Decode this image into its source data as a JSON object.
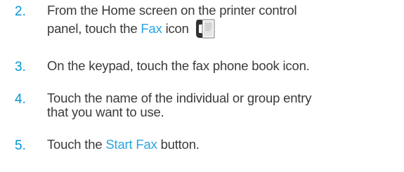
{
  "steps": [
    {
      "number": "2.",
      "line1": "From the Home screen on the printer control",
      "line2_prefix": "panel, touch the ",
      "highlight": "Fax",
      "line2_suffix": " icon",
      "icon": "fax-icon"
    },
    {
      "number": "3.",
      "text": "On the keypad, touch the fax phone book icon."
    },
    {
      "number": "4.",
      "line1": "Touch the name of the individual or group entry",
      "line2": "that you want to use."
    },
    {
      "number": "5.",
      "prefix": "Touch the ",
      "highlight": "Start Fax",
      "suffix": " button."
    }
  ],
  "colors": {
    "number": "#0096d6",
    "link": "#2aa4e0",
    "text": "#3a3a3a"
  }
}
